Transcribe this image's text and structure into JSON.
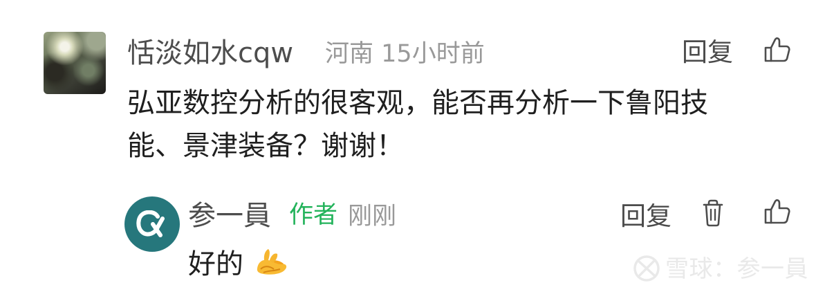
{
  "comments": [
    {
      "name": "恬淡如水cqw",
      "location": "河南",
      "time": "15小时前",
      "reply_label": "回复",
      "text_lines": [
        "弘亚数控分析的很客观，能否再分析一下鲁阳技",
        "能、景津装备？谢谢！"
      ],
      "avatar": "photo-avatar"
    },
    {
      "name": "参一員",
      "badge": "作者",
      "time": "刚刚",
      "reply_label": "回复",
      "text": "好的",
      "emoji": "ok-hand-emoji",
      "avatar": "alpha-avatar"
    }
  ],
  "icons": {
    "like": "thumbs-up-icon",
    "delete": "trash-icon",
    "watermark_logo": "xueqiu-logo"
  },
  "watermark": {
    "text": "雪球：参一員"
  },
  "colors": {
    "background": "#ffffff",
    "name": "#4d4d4d",
    "meta": "#999999",
    "comment_text": "#1f1f1f",
    "author_badge": "#23b35b",
    "avatar_teal": "#26777c",
    "watermark": "#e9e9e9"
  }
}
